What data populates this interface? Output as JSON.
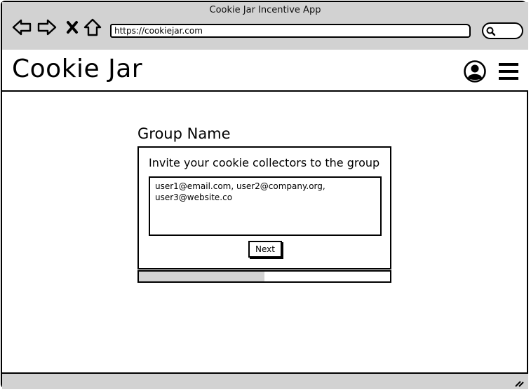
{
  "window": {
    "title": "Cookie Jar Incentive App",
    "url": "https://cookiejar.com"
  },
  "nav_icons": [
    "back-arrow-icon",
    "forward-arrow-icon",
    "close-x-icon",
    "home-icon",
    "search-icon"
  ],
  "header": {
    "app_title": "Cookie Jar",
    "icons": [
      "user-avatar-icon",
      "hamburger-menu-icon"
    ]
  },
  "main": {
    "group_name": "Group Name",
    "invite_prompt": "Invite your cookie collectors to the group",
    "emails_value": "user1@email.com, user2@company.org, user3@website.co",
    "next_label": "Next",
    "progress_fraction": 0.5
  },
  "colors": {
    "chrome_gray": "#d2d2d2",
    "stroke": "#000000"
  }
}
